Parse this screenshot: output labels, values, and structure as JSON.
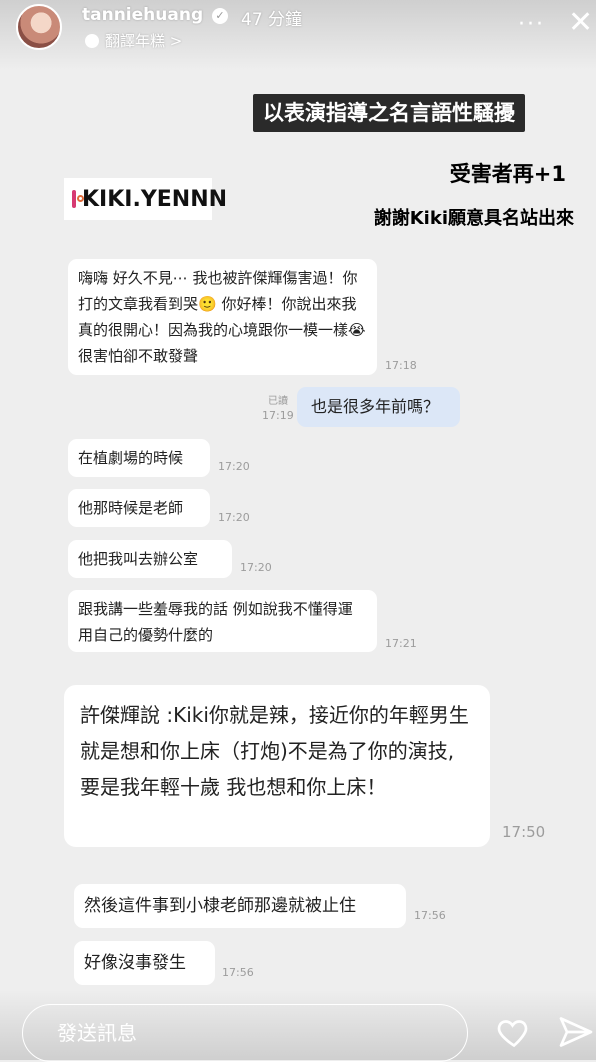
{
  "header": {
    "username": "tanniehuang",
    "time_ago": "47 分鐘",
    "translate_label": "翻譯年糕 >",
    "more_label": "···",
    "close_label": "✕"
  },
  "overlay": {
    "banner": "以表演指導之名言語性騷擾",
    "victim_line": "受害者再+1",
    "thanks_line": "謝謝Kiki願意具名站出來",
    "ig_handle": "KIKI.YENNN"
  },
  "chat": [
    {
      "text": "嗨嗨 好久不見⋯ 我也被許傑輝傷害過！你打的文章我看到哭🙂 你好棒！你說出來我真的很開心！因為我的心境跟你一模一樣😭很害怕卻不敢發聲",
      "time": "17:18"
    },
    {
      "text": "也是很多年前嗎？",
      "time": "17:19",
      "read": "已讀",
      "mine": true
    },
    {
      "text": "在植劇場的時候",
      "time": "17:20"
    },
    {
      "text": "他那時候是老師",
      "time": "17:20"
    },
    {
      "text": "他把我叫去辦公室",
      "time": "17:20"
    },
    {
      "text": "跟我講一些羞辱我的話 例如說我不懂得運用自己的優勢什麼的",
      "time": "17:21"
    },
    {
      "text": "許傑輝說 :Kiki你就是辣，接近你的年輕男生就是想和你上床（打炮)不是為了你的演技,要是我年輕十歲 我也想和你上床！",
      "time": "17:50"
    },
    {
      "text": "然後這件事到小棣老師那邊就被止住",
      "time": "17:56"
    },
    {
      "text": "好像沒事發生",
      "time": "17:56"
    }
  ],
  "footer": {
    "send_placeholder": "發送訊息"
  }
}
